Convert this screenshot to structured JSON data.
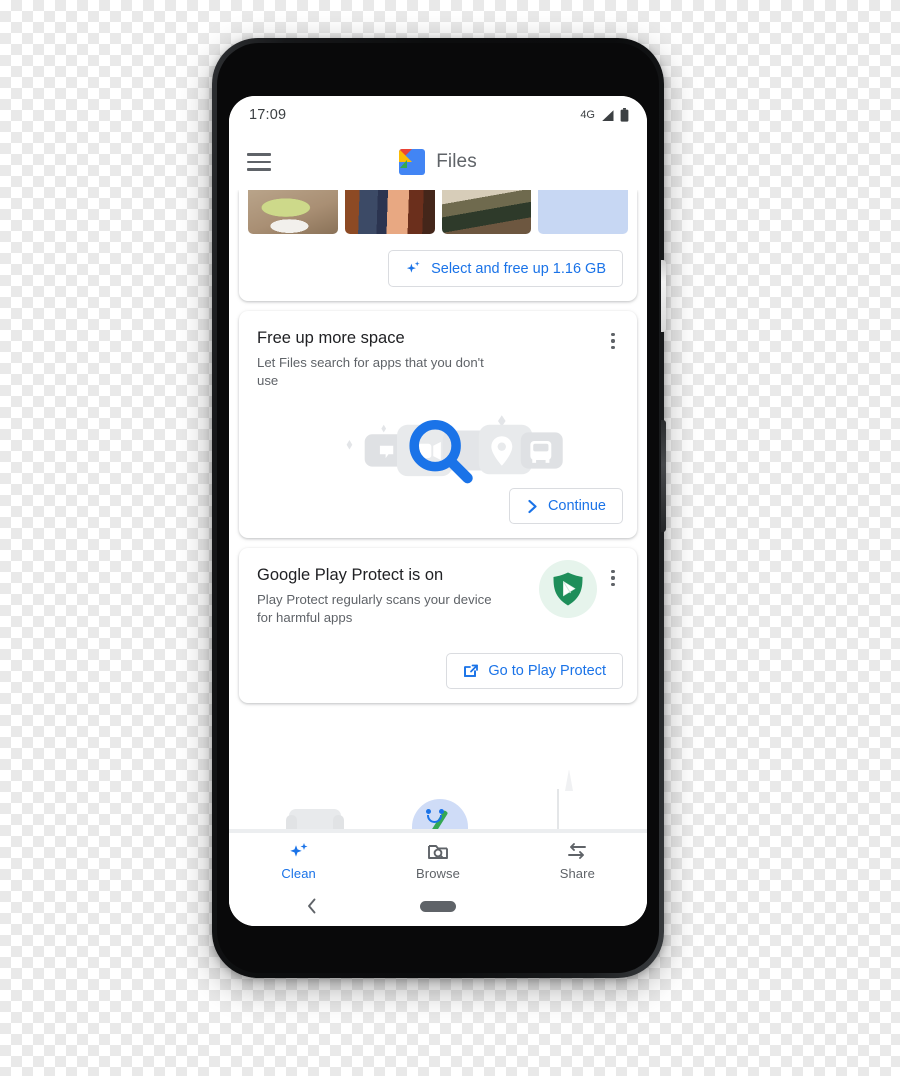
{
  "status_bar": {
    "time": "17:09",
    "network_type": "4G",
    "signal_icon": "signal-bars-icon",
    "battery_icon": "battery-icon"
  },
  "app_bar": {
    "menu_icon": "hamburger-menu-icon",
    "logo_icon": "files-app-logo",
    "title": "Files"
  },
  "cards": {
    "photo_cleanup": {
      "thumbnails": [
        {
          "name": "salad-photo"
        },
        {
          "name": "people-photo"
        },
        {
          "name": "room-photo"
        },
        {
          "name": "placeholder-tile"
        }
      ],
      "button_label": "Select and free up 1.16 GB",
      "button_icon": "sparkle-icon"
    },
    "free_up_space": {
      "title": "Free up more space",
      "subtitle": "Let Files search for apps that you don't use",
      "overflow_icon": "more-vert-icon",
      "illustration_icon": "magnifying-glass-illustration",
      "button_label": "Continue",
      "button_icon": "chevron-right-icon"
    },
    "play_protect": {
      "title": "Google Play Protect is on",
      "subtitle": "Play Protect regularly scans your device for harmful apps",
      "overflow_icon": "more-vert-icon",
      "badge_icon": "play-protect-shield-icon",
      "button_label": "Go to Play Protect",
      "button_icon": "external-link-icon"
    }
  },
  "bottom_nav": {
    "items": [
      {
        "label": "Clean",
        "icon": "sparkles-icon",
        "active": true
      },
      {
        "label": "Browse",
        "icon": "folder-search-icon",
        "active": false
      },
      {
        "label": "Share",
        "icon": "share-arrows-icon",
        "active": false
      }
    ]
  },
  "android_nav": {
    "back_icon": "chevron-left-icon",
    "home_icon": "home-pill-icon"
  },
  "colors": {
    "accent_blue": "#1a73e8",
    "play_protect_green": "#1e8e5a",
    "text_primary": "#202124",
    "text_secondary": "#5f6368",
    "card_background": "#ffffff"
  }
}
